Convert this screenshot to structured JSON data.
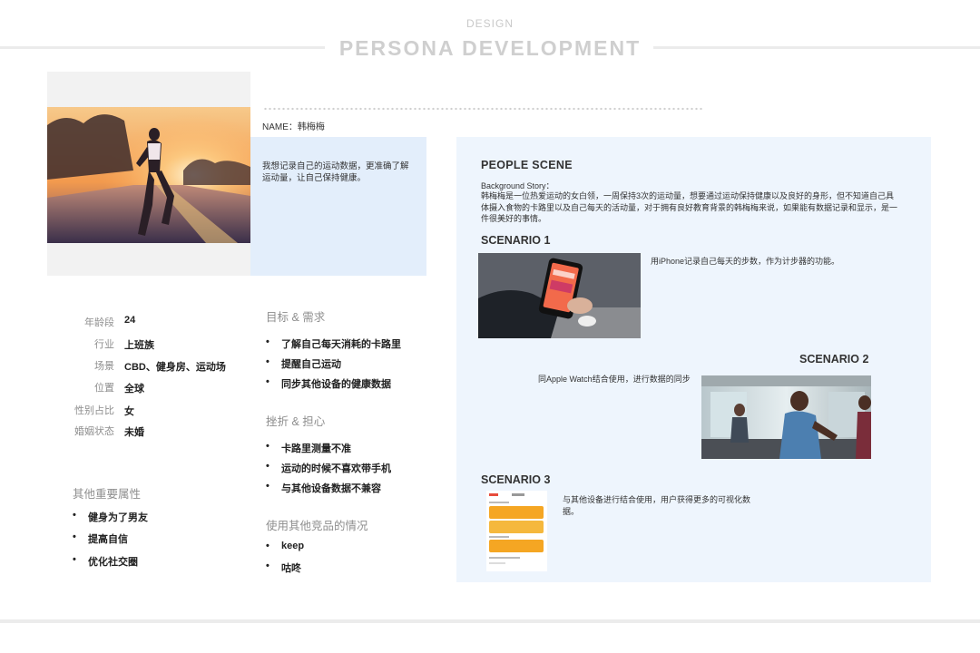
{
  "header": {
    "kicker": "DESIGN",
    "title": "PERSONA DEVELOPMENT"
  },
  "persona": {
    "name_label": "NAME：韩梅梅",
    "quote": "我想记录自己的运动数据，更准确了解运动量，让自己保持健康。"
  },
  "info": [
    {
      "key": "年龄段",
      "value": "24"
    },
    {
      "key": "行业",
      "value": "上班族"
    },
    {
      "key": "场景",
      "value": "CBD、健身房、运动场"
    },
    {
      "key": "位置",
      "value": "全球"
    },
    {
      "key": "性别占比",
      "value": "女"
    },
    {
      "key": "婚姻状态",
      "value": "未婚"
    }
  ],
  "other_attributes": {
    "title": "其他重要属性",
    "items": [
      "健身为了男友",
      "提高自信",
      "优化社交圈"
    ]
  },
  "goals": {
    "title": "目标 & 需求",
    "items": [
      "了解自己每天消耗的卡路里",
      "提醒自己运动",
      "同步其他设备的健康数据"
    ]
  },
  "frustrations": {
    "title": "挫折 & 担心",
    "items": [
      "卡路里测量不准",
      "运动的时候不喜欢带手机",
      "与其他设备数据不兼容"
    ]
  },
  "competitors": {
    "title": "使用其他竞品的情况",
    "items": [
      "keep",
      "咕咚"
    ]
  },
  "scene": {
    "title": "PEOPLE SCENE",
    "background_label": "Background Story：",
    "background_story": "韩梅梅是一位热爱运动的女白领，一周保持3次的运动量，想要通过运动保持健康以及良好的身形，但不知道自己具体摄入食物的卡路里以及自己每天的活动量，对于拥有良好教育背景的韩梅梅来说，如果能有数据记录和显示，是一件很美好的事情。",
    "scenario1": {
      "title": "SCENARIO 1",
      "desc": "用iPhone记录自己每天的步数，作为计步器的功能。"
    },
    "scenario2": {
      "title": "SCENARIO 2",
      "desc": "同Apple Watch结合使用，进行数据的同步"
    },
    "scenario3": {
      "title": "SCENARIO 3",
      "desc": "与其他设备进行结合使用，用户获得更多的可视化数据。"
    }
  },
  "colors": {
    "panel": "#eef5fd",
    "quote_box": "#e3eefb",
    "accent_orange": "#f5a623"
  }
}
